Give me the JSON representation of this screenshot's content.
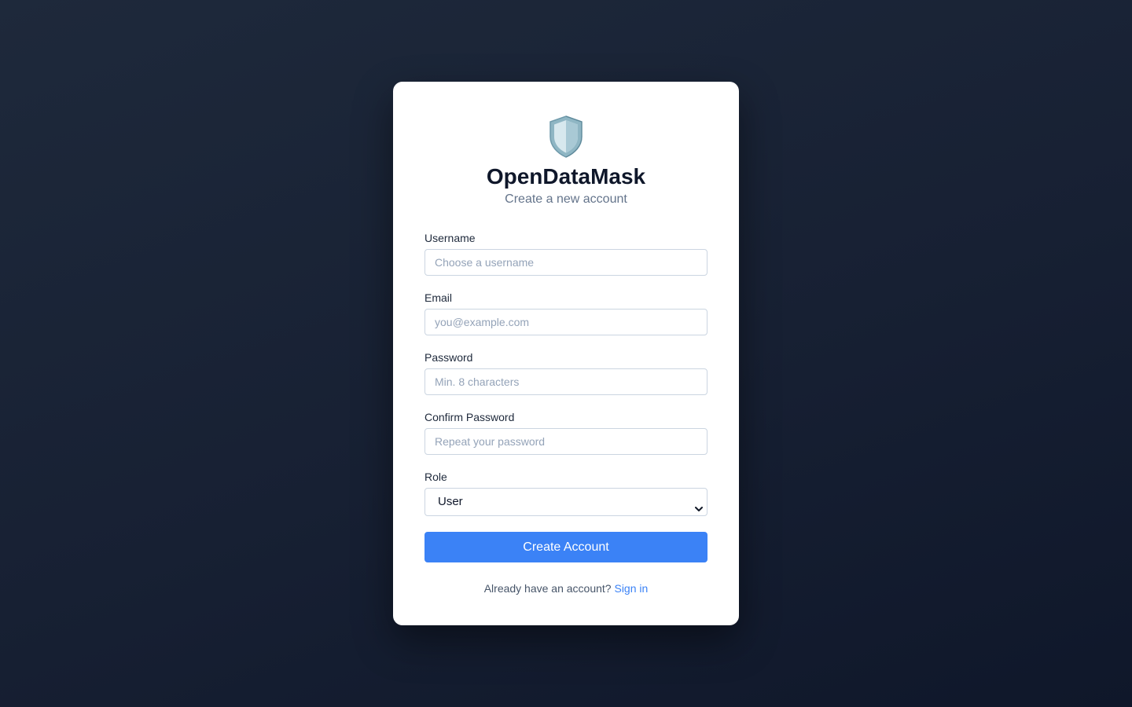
{
  "app": {
    "title": "OpenDataMask",
    "subtitle": "Create a new account",
    "logo_icon": "shield-icon"
  },
  "form": {
    "username": {
      "label": "Username",
      "value": "",
      "placeholder": "Choose a username"
    },
    "email": {
      "label": "Email",
      "value": "",
      "placeholder": "you@example.com"
    },
    "password": {
      "label": "Password",
      "value": "",
      "placeholder": "Min. 8 characters"
    },
    "confirm_password": {
      "label": "Confirm Password",
      "value": "",
      "placeholder": "Repeat your password"
    },
    "role": {
      "label": "Role",
      "selected": "User",
      "icon": "chevron-down-icon"
    },
    "submit_label": "Create Account"
  },
  "footer": {
    "text": "Already have an account?",
    "link_text": "Sign in"
  },
  "colors": {
    "accent": "#3b82f6",
    "background": "#1e293b",
    "card": "#ffffff",
    "title": "#0f172a",
    "muted": "#64748b"
  }
}
